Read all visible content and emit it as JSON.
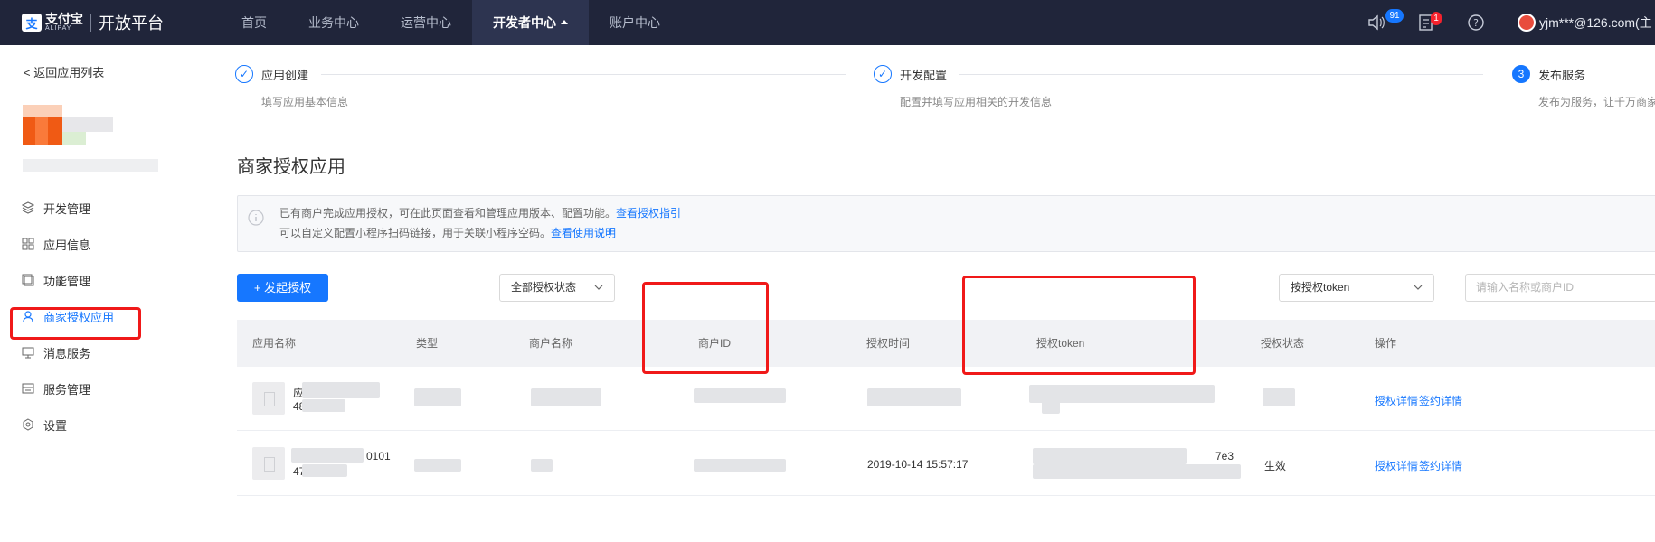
{
  "topbar": {
    "logo_text": "支付宝",
    "logo_sub": "ALIPAY",
    "platform_title": "开放平台",
    "nav": [
      "首页",
      "业务中心",
      "运营中心",
      "开发者中心",
      "账户中心"
    ],
    "active_nav": "开发者中心",
    "notice_count": "91",
    "task_count": "1",
    "user_email": "yjm***@126.com(主"
  },
  "sidebar": {
    "back_label": "返回应用列表",
    "menu": [
      {
        "label": "开发管理",
        "icon": "layers-icon"
      },
      {
        "label": "应用信息",
        "icon": "grid-icon"
      },
      {
        "label": "功能管理",
        "icon": "feature-icon"
      },
      {
        "label": "商家授权应用",
        "icon": "user-icon"
      },
      {
        "label": "消息服务",
        "icon": "message-icon"
      },
      {
        "label": "服务管理",
        "icon": "service-icon"
      },
      {
        "label": "设置",
        "icon": "settings-icon"
      }
    ]
  },
  "steps": [
    {
      "title": "应用创建",
      "desc": "填写应用基本信息",
      "state": "done"
    },
    {
      "title": "开发配置",
      "desc": "配置并填写应用相关的开发信息",
      "state": "done"
    },
    {
      "number": "3",
      "title": "发布服务",
      "desc": "发布为服务，让千万商家",
      "state": "current"
    }
  ],
  "page_title": "商家授权应用",
  "notice": {
    "line1": "已有商户完成应用授权，可在此页面查看和管理应用版本、配置功能。",
    "line1_link": "查看授权指引",
    "line2": "可以自定义配置小程序扫码链接，用于关联小程序空码。",
    "line2_link": "查看使用说明"
  },
  "toolbar": {
    "start_auth_label": "+ 发起授权",
    "status_filter": "全部授权状态",
    "token_filter": "按授权token",
    "search_placeholder": "请输入名称或商户ID"
  },
  "table": {
    "headers": [
      "应用名称",
      "类型",
      "商户名称",
      "商户ID",
      "授权时间",
      "授权token",
      "授权状态",
      "操作"
    ],
    "rows": [
      {
        "name_partial": "应",
        "id_partial": "48",
        "auth_time": "",
        "token_tail": "",
        "status": "",
        "actions": [
          "授权详情",
          "签约详情"
        ]
      },
      {
        "name_partial": "",
        "name_suffix": "0101",
        "id_partial": "47",
        "auth_time": "2019-10-14 15:57:17",
        "token_tail": "7e3",
        "status": "生效",
        "actions": [
          "授权详情",
          "签约详情"
        ]
      }
    ]
  },
  "colors": {
    "accent": "#1677ff",
    "topbar": "#20253a",
    "highlight": "#f01919",
    "badge": "#1677ff",
    "badge_alert": "#f5222d"
  }
}
